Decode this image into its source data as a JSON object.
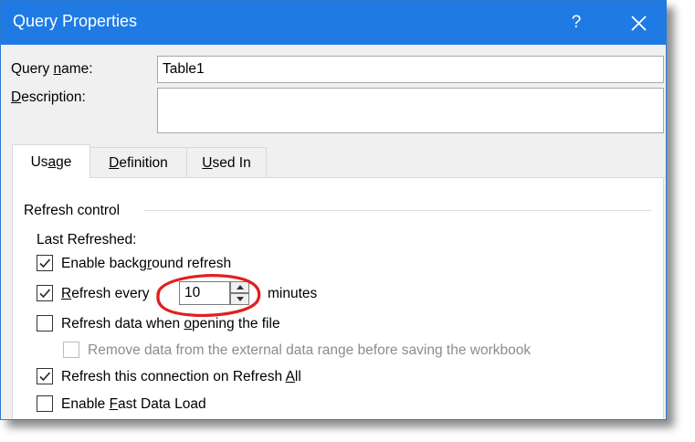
{
  "window": {
    "title": "Query Properties",
    "help": "?",
    "accent": "#1f7be3"
  },
  "form": {
    "query_name_label": "Query name:",
    "query_name_value": "Table1",
    "description_label": "Description:",
    "description_value": ""
  },
  "tabs": [
    {
      "label": "Usage",
      "active": true
    },
    {
      "label": "Definition",
      "active": false
    },
    {
      "label": "Used In",
      "active": false
    }
  ],
  "usage": {
    "group_title": "Refresh control",
    "last_refreshed_label": "Last Refreshed:",
    "options": [
      {
        "label": "Enable background refresh",
        "checked": true,
        "enabled": true
      },
      {
        "label": "Refresh every",
        "checked": true,
        "enabled": true
      },
      {
        "label": "Refresh data when opening the file",
        "checked": false,
        "enabled": true
      },
      {
        "label": "Remove data from the external data range before saving the workbook",
        "checked": false,
        "enabled": false
      },
      {
        "label": "Refresh this connection on Refresh All",
        "checked": true,
        "enabled": true
      },
      {
        "label": "Enable Fast Data Load",
        "checked": false,
        "enabled": true
      }
    ],
    "refresh_interval_value": "10",
    "refresh_interval_unit": "minutes"
  },
  "annotation": {
    "color": "#e02020",
    "icon": "red-circle-highlight"
  }
}
